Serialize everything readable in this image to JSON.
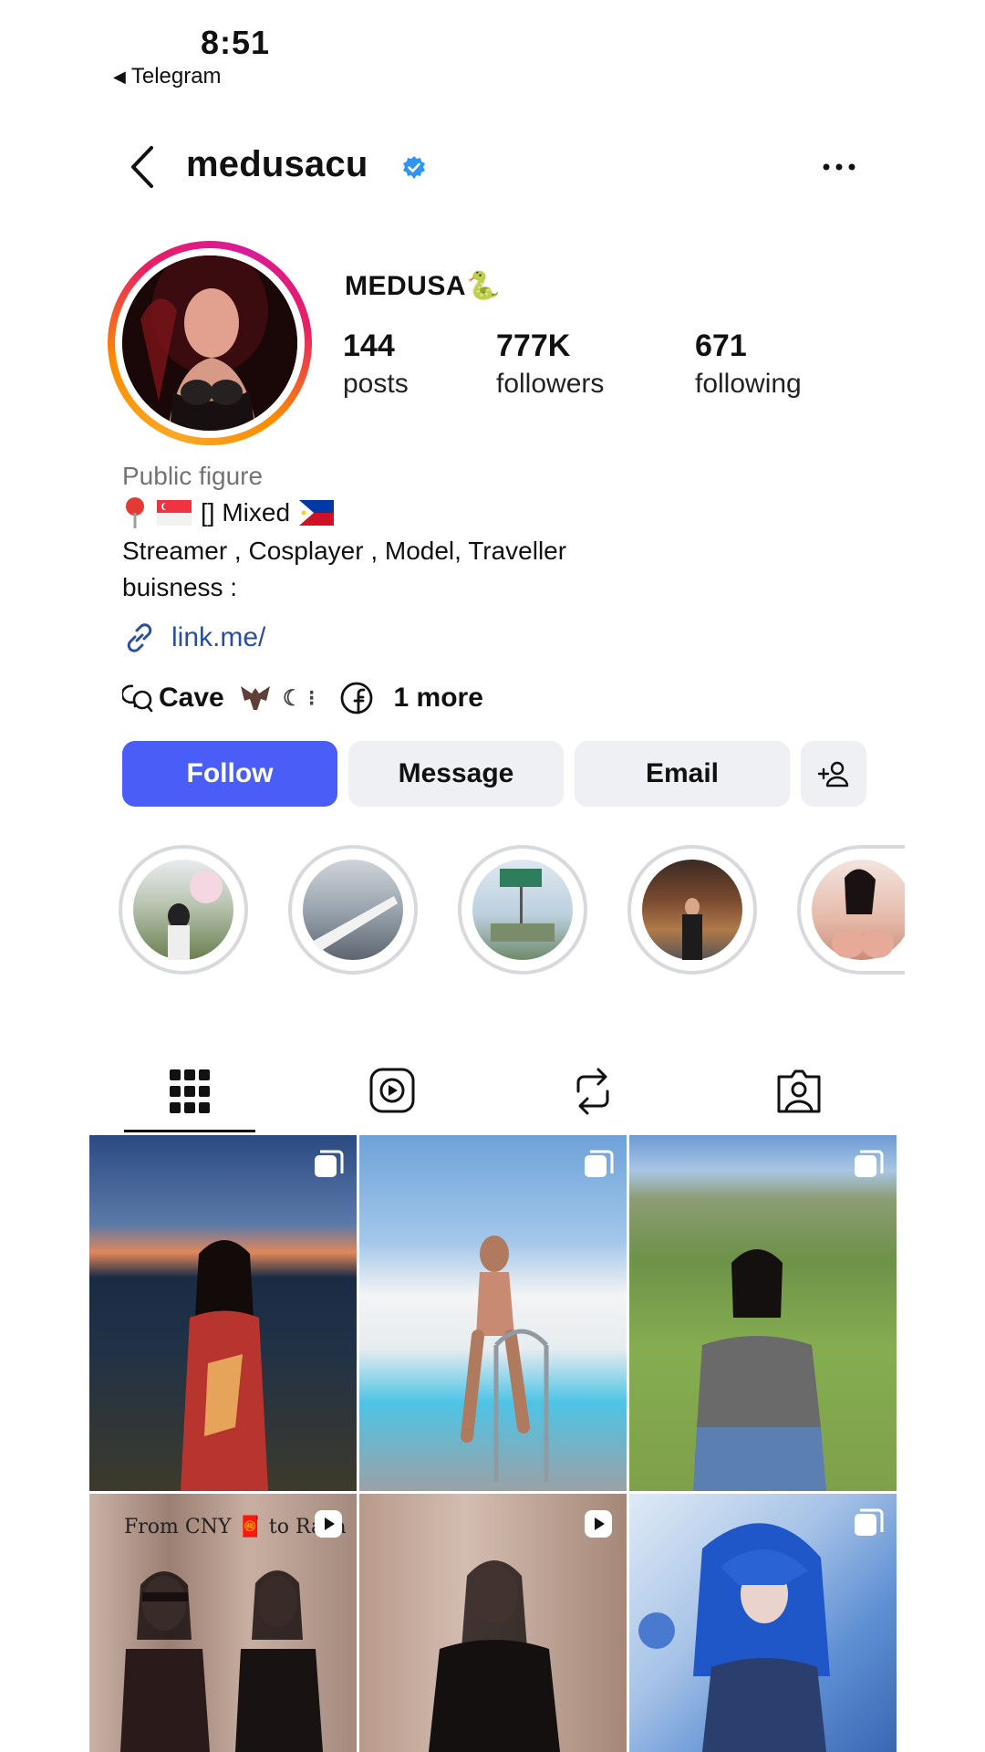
{
  "status": {
    "time": "8:51",
    "back_app": "Telegram"
  },
  "header": {
    "username": "medusacu"
  },
  "profile": {
    "display_name": "MEDUSA🐍",
    "stats": [
      {
        "value": "144",
        "label": "posts"
      },
      {
        "value": "777K",
        "label": "followers"
      },
      {
        "value": "671",
        "label": "following"
      }
    ],
    "category": "Public figure",
    "bio_line1": "[] Mixed",
    "bio_line2": "Streamer , Cosplayer , Model, Traveller",
    "bio_line3": "buisness :",
    "link": "link.me/",
    "social_text": "Cave",
    "more_links": "1 more"
  },
  "buttons": {
    "follow": "Follow",
    "message": "Message",
    "email": "Email"
  },
  "grid_captions": {
    "post4": "From CNY 🧧 to Raya"
  },
  "colors": {
    "follow": "#4a5df6",
    "verified": "#2f95f3",
    "link": "#2b4fa0"
  }
}
